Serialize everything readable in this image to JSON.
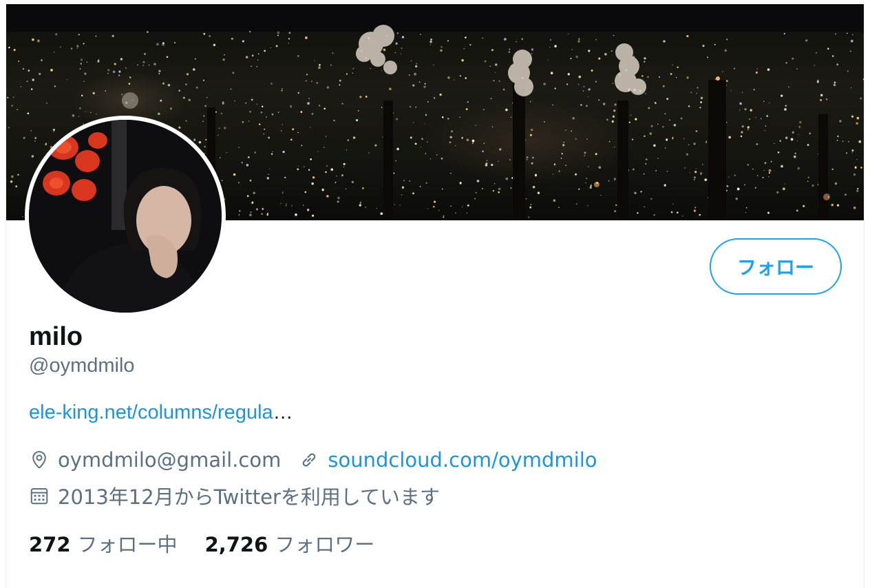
{
  "profile": {
    "display_name": "milo",
    "handle": "@oymdmilo",
    "bio_link": "ele-king.net/columns/regula",
    "bio_ellipsis": "…",
    "location": "oymdmilo@gmail.com",
    "website": "soundcloud.com/oymdmilo",
    "joined": "2013年12月からTwitterを利用しています"
  },
  "actions": {
    "follow_label": "フォロー"
  },
  "stats": {
    "following_count": "272",
    "following_label": "フォロー中",
    "followers_count": "2,726",
    "followers_label": "フォロワー"
  },
  "icons": {
    "location": "location-pin-icon",
    "website": "link-icon",
    "joined": "calendar-icon"
  },
  "colors": {
    "accent": "#1da1f2",
    "link": "#1b95e0",
    "secondary_text": "#5b7083",
    "primary_text": "#0f1419"
  }
}
